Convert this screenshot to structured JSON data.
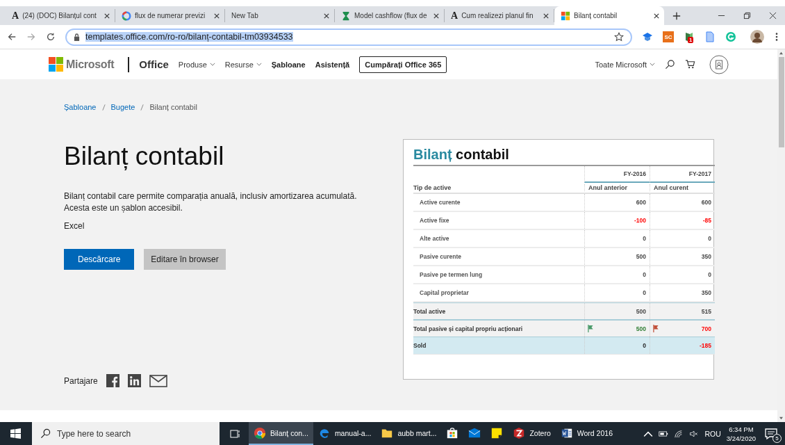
{
  "browser": {
    "tabs": [
      {
        "title": "(24) (DOC) Bilanțul cont",
        "kind": "letter",
        "glyph": "A",
        "selected": false
      },
      {
        "title": "flux de numerar previzi",
        "kind": "google",
        "selected": false
      },
      {
        "title": "New Tab",
        "kind": "none",
        "selected": false
      },
      {
        "title": "Model cashflow (flux de",
        "kind": "cashflow",
        "selected": false
      },
      {
        "title": "Cum realizezi planul fin",
        "kind": "letter",
        "glyph": "A",
        "selected": false
      },
      {
        "title": "Bilanț contabil",
        "kind": "windows",
        "selected": true
      }
    ],
    "url": "templates.office.com/ro-ro/bilanț-contabil-tm03934533",
    "extensions": [
      {
        "kind": "cap"
      },
      {
        "kind": "text",
        "label": "SC"
      },
      {
        "kind": "badge",
        "label": "1"
      },
      {
        "kind": "doc"
      },
      {
        "kind": "grammar"
      }
    ]
  },
  "site_header": {
    "brand": "Microsoft",
    "product": "Office",
    "nav": [
      {
        "label": "Produse",
        "dropdown": true
      },
      {
        "label": "Resurse",
        "dropdown": true
      },
      {
        "label": "Șabloane",
        "dropdown": false
      },
      {
        "label": "Asistență",
        "dropdown": false
      }
    ],
    "buy_button": "Cumpărați Office 365",
    "all_microsoft": "Toate Microsoft"
  },
  "breadcrumbs": [
    {
      "label": "Șabloane",
      "link": true
    },
    {
      "label": "Bugete",
      "link": true
    },
    {
      "label": "Bilanț contabil",
      "link": false
    }
  ],
  "title": "Bilanț contabil",
  "description": [
    "Bilanț contabil care permite comparația anuală, inclusiv amortizarea acumulată.",
    "Acesta este un șablon accesibil."
  ],
  "app": "Excel",
  "buttons": [
    {
      "label": "Descărcare",
      "kind": "primary"
    },
    {
      "label": "Editare în browser",
      "kind": "secondary"
    }
  ],
  "share_label": "Partajare",
  "preview": {
    "title_first": "Bilanț",
    "title_rest": "contabil",
    "years": [
      "FY-2016",
      "FY-2017"
    ],
    "header": "Tip de active",
    "subheaders": [
      "Anul anterior",
      "Anul curent"
    ],
    "rows": [
      {
        "label": "Active curente",
        "kind": "item",
        "values": [
          {
            "text": "600"
          },
          {
            "text": "600"
          }
        ]
      },
      {
        "label": "Active fixe",
        "kind": "item",
        "values": [
          {
            "text": "-100",
            "color": "#ff0000"
          },
          {
            "text": "-85",
            "color": "#ff0000"
          }
        ]
      },
      {
        "label": "Alte active",
        "kind": "item",
        "values": [
          {
            "text": "0"
          },
          {
            "text": "0"
          }
        ]
      },
      {
        "label": "Pasive curente",
        "kind": "item",
        "values": [
          {
            "text": "500"
          },
          {
            "text": "350"
          }
        ]
      },
      {
        "label": "Pasive pe termen lung",
        "kind": "item",
        "values": [
          {
            "text": "0"
          },
          {
            "text": "0"
          }
        ]
      },
      {
        "label": "Capital proprietar",
        "kind": "item",
        "values": [
          {
            "text": "0"
          },
          {
            "text": "350"
          }
        ]
      },
      {
        "label": "Total active",
        "kind": "total",
        "values": [
          {
            "text": "500"
          },
          {
            "text": "515"
          }
        ]
      },
      {
        "label": "Total pasive și capital propriu acționari",
        "kind": "total",
        "values": [
          {
            "text": "500",
            "color": "#2e7d32",
            "flag": {
              "color": "#4a9a6a"
            }
          },
          {
            "text": "700",
            "color": "#ff0000",
            "flag": {
              "color": "#c0503a"
            }
          }
        ]
      },
      {
        "label": "Sold",
        "kind": "sold",
        "values": [
          {
            "text": "0"
          },
          {
            "text": "-185",
            "color": "#ff0000"
          }
        ]
      }
    ]
  },
  "taskbar": {
    "search_placeholder": "Type here to search",
    "apps": [
      {
        "kind": "chrome",
        "label": "Bilanț con...",
        "selected": true
      },
      {
        "kind": "edge",
        "label": "manual-a...",
        "selected": false
      },
      {
        "kind": "folder",
        "label": "aubb mart...",
        "selected": false
      },
      {
        "kind": "store",
        "selected": false
      },
      {
        "kind": "mail",
        "selected": false
      },
      {
        "kind": "notes",
        "selected": false
      },
      {
        "kind": "zotero",
        "label": "Zotero",
        "selected": false
      },
      {
        "kind": "word",
        "label": "Word 2016",
        "selected": false
      }
    ],
    "language": "ROU",
    "time": "6:34 PM",
    "date": "3/24/2020",
    "notifications": "5"
  }
}
